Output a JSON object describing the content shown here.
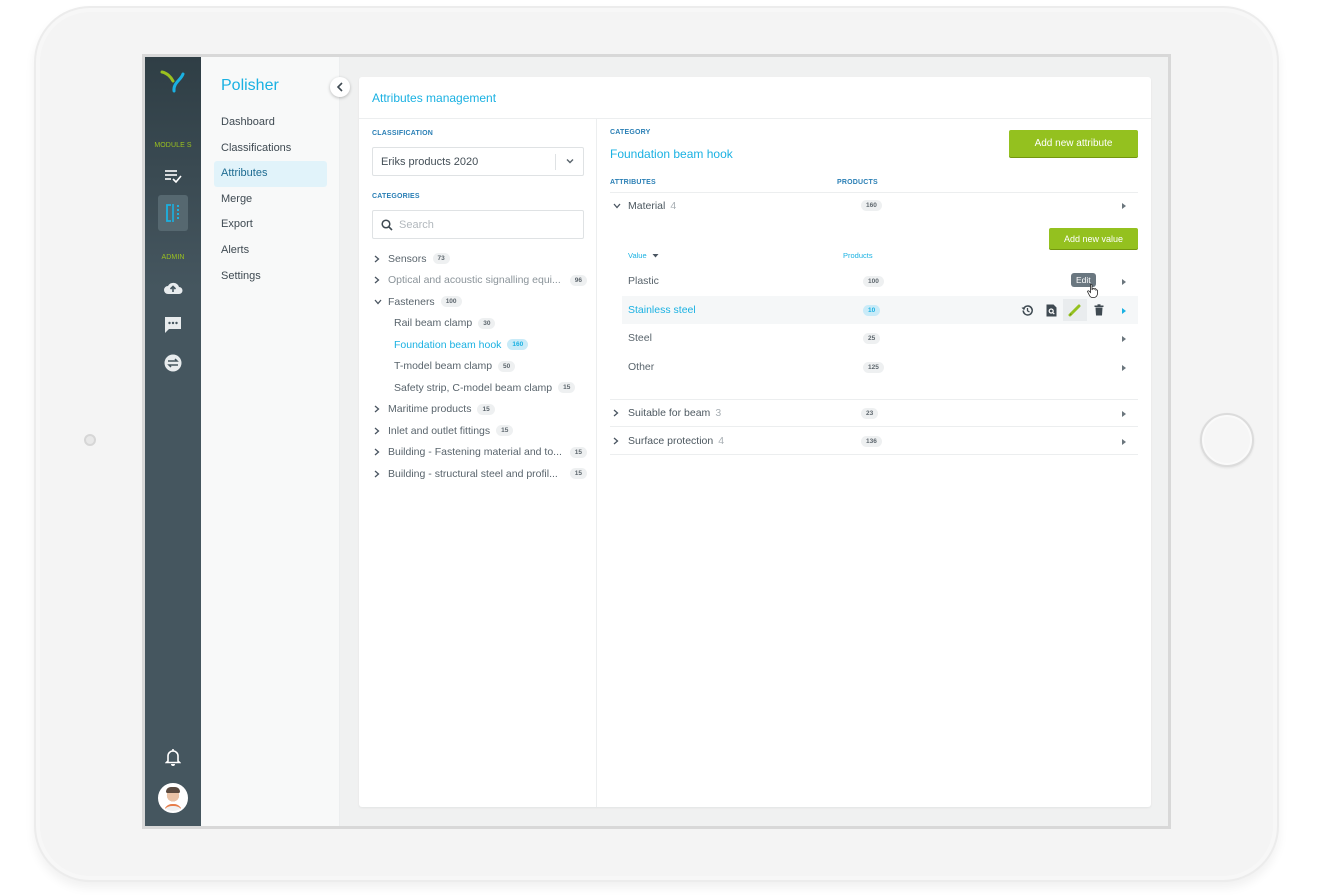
{
  "app": {
    "name": "Polisher",
    "rail": {
      "modules_label": "MODULE S",
      "admin_label": "ADMIN",
      "module_icons": [
        "checklist-icon",
        "split-view-icon"
      ],
      "admin_icons": [
        "cloud-upload-icon",
        "chat-icon",
        "sync-icon"
      ],
      "bottom_icons": [
        "bell-icon",
        "avatar"
      ]
    },
    "nav": {
      "items": [
        {
          "label": "Dashboard"
        },
        {
          "label": "Classifications"
        },
        {
          "label": "Attributes",
          "active": true
        },
        {
          "label": "Merge"
        },
        {
          "label": "Export"
        },
        {
          "label": "Alerts"
        },
        {
          "label": "Settings"
        }
      ]
    }
  },
  "page": {
    "title": "Attributes management",
    "classification": {
      "label": "CLASSIFICATION",
      "selected": "Eriks products 2020"
    },
    "categories": {
      "label": "CATEGORIES",
      "search_placeholder": "Search",
      "tree": [
        {
          "label": "Sensors",
          "count": "73",
          "expanded": false
        },
        {
          "label": "Optical and acoustic signalling equi...",
          "count": "96",
          "expanded": false
        },
        {
          "label": "Fasteners",
          "count": "100",
          "expanded": true,
          "children": [
            {
              "label": "Rail beam clamp",
              "count": "30"
            },
            {
              "label": "Foundation beam hook",
              "count": "160",
              "active": true
            },
            {
              "label": "T-model beam clamp",
              "count": "50"
            },
            {
              "label": "Safety strip, C-model beam clamp",
              "count": "15"
            }
          ]
        },
        {
          "label": "Maritime products",
          "count": "15",
          "expanded": false
        },
        {
          "label": "Inlet and outlet fittings",
          "count": "15",
          "expanded": false
        },
        {
          "label": "Building - Fastening material and to...",
          "count": "15",
          "expanded": false
        },
        {
          "label": "Building - structural steel and profil...",
          "count": "15",
          "expanded": false
        }
      ]
    },
    "category": {
      "label": "CATEGORY",
      "name": "Foundation beam hook",
      "add_attribute_label": "Add new attribute",
      "attributes_header": "ATTRIBUTES",
      "products_header": "PRODUCTS",
      "attributes": [
        {
          "name": "Material",
          "value_count": "4",
          "products": "160",
          "expanded": true,
          "add_value_label": "Add new value",
          "value_header": "Value",
          "value_products_header": "Products",
          "values": [
            {
              "name": "Plastic",
              "products": "100"
            },
            {
              "name": "Stainless steel",
              "products": "10",
              "selected": true
            },
            {
              "name": "Steel",
              "products": "25"
            },
            {
              "name": "Other",
              "products": "125"
            }
          ]
        },
        {
          "name": "Suitable for beam",
          "value_count": "3",
          "products": "23",
          "expanded": false
        },
        {
          "name": "Surface protection",
          "value_count": "4",
          "products": "136",
          "expanded": false
        }
      ],
      "row_actions": {
        "history": "history-icon",
        "inspect": "find-in-page-icon",
        "edit": "pencil-icon",
        "delete": "trash-icon",
        "tooltip": "Edit"
      }
    }
  },
  "colors": {
    "accent": "#1ab1e2",
    "brand_green": "#94c11f",
    "rail": "#45565f"
  }
}
